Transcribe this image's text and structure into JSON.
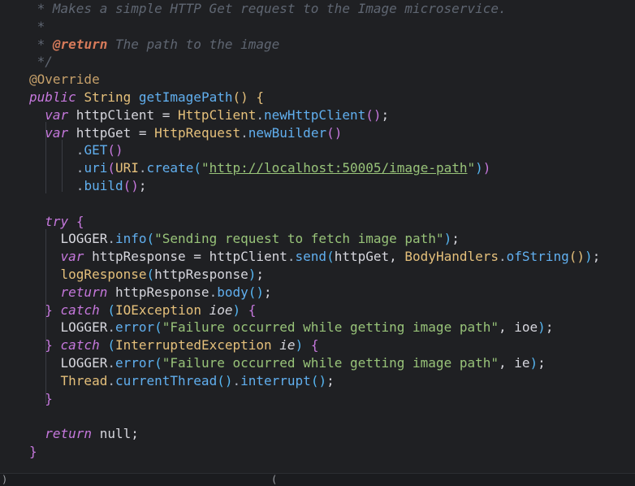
{
  "editor": {
    "lines": [
      [
        {
          "t": " * Makes a simple HTTP Get request to the Image microservice.",
          "k": "comment"
        }
      ],
      [
        {
          "t": " *",
          "k": "comment"
        }
      ],
      [
        {
          "t": " * ",
          "k": "comment"
        },
        {
          "t": "@return",
          "k": "doctag"
        },
        {
          "t": " The path to the image",
          "k": "comment"
        }
      ],
      [
        {
          "t": " */",
          "k": "comment"
        }
      ],
      [
        {
          "t": "@Override",
          "k": "annot"
        }
      ],
      [
        {
          "t": "public",
          "k": "kw"
        },
        {
          "t": " ",
          "k": "plain"
        },
        {
          "t": "String",
          "k": "type"
        },
        {
          "t": " ",
          "k": "plain"
        },
        {
          "t": "getImagePath",
          "k": "fn"
        },
        {
          "t": "()",
          "k": "b1"
        },
        {
          "t": " ",
          "k": "plain"
        },
        {
          "t": "{",
          "k": "b1"
        }
      ],
      [
        {
          "t": "  var",
          "k": "kw"
        },
        {
          "t": " httpClient = ",
          "k": "plain"
        },
        {
          "t": "HttpClient",
          "k": "type"
        },
        {
          "t": ".",
          "k": "punct"
        },
        {
          "t": "newHttpClient",
          "k": "fn"
        },
        {
          "t": "()",
          "k": "b2"
        },
        {
          "t": ";",
          "k": "plain"
        }
      ],
      [
        {
          "t": "  var",
          "k": "kw"
        },
        {
          "t": " httpGet = ",
          "k": "plain"
        },
        {
          "t": "HttpRequest",
          "k": "type"
        },
        {
          "t": ".",
          "k": "punct"
        },
        {
          "t": "newBuilder",
          "k": "fn"
        },
        {
          "t": "()",
          "k": "b2"
        }
      ],
      [
        {
          "t": "      .",
          "k": "punct"
        },
        {
          "t": "GET",
          "k": "fn"
        },
        {
          "t": "()",
          "k": "b2"
        }
      ],
      [
        {
          "t": "      .",
          "k": "punct"
        },
        {
          "t": "uri",
          "k": "fn"
        },
        {
          "t": "(",
          "k": "b2"
        },
        {
          "t": "URI",
          "k": "type"
        },
        {
          "t": ".",
          "k": "punct"
        },
        {
          "t": "create",
          "k": "fn"
        },
        {
          "t": "(",
          "k": "b3"
        },
        {
          "t": "\"",
          "k": "str"
        },
        {
          "t": "http://localhost:50005/image-path",
          "k": "url"
        },
        {
          "t": "\"",
          "k": "str"
        },
        {
          "t": ")",
          "k": "b3"
        },
        {
          "t": ")",
          "k": "b2"
        }
      ],
      [
        {
          "t": "      .",
          "k": "punct"
        },
        {
          "t": "build",
          "k": "fn"
        },
        {
          "t": "()",
          "k": "b2"
        },
        {
          "t": ";",
          "k": "plain"
        }
      ],
      [],
      [
        {
          "t": "  try",
          "k": "kw"
        },
        {
          "t": " ",
          "k": "plain"
        },
        {
          "t": "{",
          "k": "b2"
        }
      ],
      [
        {
          "t": "    LOGGER",
          "k": "plain"
        },
        {
          "t": ".",
          "k": "punct"
        },
        {
          "t": "info",
          "k": "fn"
        },
        {
          "t": "(",
          "k": "b3"
        },
        {
          "t": "\"Sending request to fetch image path\"",
          "k": "str"
        },
        {
          "t": ")",
          "k": "b3"
        },
        {
          "t": ";",
          "k": "plain"
        }
      ],
      [
        {
          "t": "    var",
          "k": "kw"
        },
        {
          "t": " httpResponse = httpClient",
          "k": "plain"
        },
        {
          "t": ".",
          "k": "punct"
        },
        {
          "t": "send",
          "k": "fn"
        },
        {
          "t": "(",
          "k": "b3"
        },
        {
          "t": "httpGet, ",
          "k": "plain"
        },
        {
          "t": "BodyHandlers",
          "k": "type"
        },
        {
          "t": ".",
          "k": "punct"
        },
        {
          "t": "ofString",
          "k": "fn"
        },
        {
          "t": "()",
          "k": "b1"
        },
        {
          "t": ")",
          "k": "b3"
        },
        {
          "t": ";",
          "k": "plain"
        }
      ],
      [
        {
          "t": "    logResponse",
          "k": "type"
        },
        {
          "t": "(",
          "k": "b3"
        },
        {
          "t": "httpResponse",
          "k": "plain"
        },
        {
          "t": ")",
          "k": "b3"
        },
        {
          "t": ";",
          "k": "plain"
        }
      ],
      [
        {
          "t": "    return",
          "k": "kw"
        },
        {
          "t": " httpResponse",
          "k": "plain"
        },
        {
          "t": ".",
          "k": "punct"
        },
        {
          "t": "body",
          "k": "fn"
        },
        {
          "t": "()",
          "k": "b3"
        },
        {
          "t": ";",
          "k": "plain"
        }
      ],
      [
        {
          "t": "  }",
          "k": "b2"
        },
        {
          "t": " ",
          "k": "plain"
        },
        {
          "t": "catch",
          "k": "kw"
        },
        {
          "t": " ",
          "k": "plain"
        },
        {
          "t": "(",
          "k": "b3"
        },
        {
          "t": "IOException",
          "k": "type"
        },
        {
          "t": " ",
          "k": "plain"
        },
        {
          "t": "ioe",
          "k": "param"
        },
        {
          "t": ")",
          "k": "b3"
        },
        {
          "t": " ",
          "k": "plain"
        },
        {
          "t": "{",
          "k": "b2"
        }
      ],
      [
        {
          "t": "    LOGGER",
          "k": "plain"
        },
        {
          "t": ".",
          "k": "punct"
        },
        {
          "t": "error",
          "k": "fn"
        },
        {
          "t": "(",
          "k": "b3"
        },
        {
          "t": "\"Failure occurred while getting image path\"",
          "k": "str"
        },
        {
          "t": ", ioe",
          "k": "plain"
        },
        {
          "t": ")",
          "k": "b3"
        },
        {
          "t": ";",
          "k": "plain"
        }
      ],
      [
        {
          "t": "  }",
          "k": "b2"
        },
        {
          "t": " ",
          "k": "plain"
        },
        {
          "t": "catch",
          "k": "kw"
        },
        {
          "t": " ",
          "k": "plain"
        },
        {
          "t": "(",
          "k": "b3"
        },
        {
          "t": "InterruptedException",
          "k": "type"
        },
        {
          "t": " ",
          "k": "plain"
        },
        {
          "t": "ie",
          "k": "param"
        },
        {
          "t": ")",
          "k": "b3"
        },
        {
          "t": " ",
          "k": "plain"
        },
        {
          "t": "{",
          "k": "b2"
        }
      ],
      [
        {
          "t": "    LOGGER",
          "k": "plain"
        },
        {
          "t": ".",
          "k": "punct"
        },
        {
          "t": "error",
          "k": "fn"
        },
        {
          "t": "(",
          "k": "b3"
        },
        {
          "t": "\"Failure occurred while getting image path\"",
          "k": "str"
        },
        {
          "t": ", ie",
          "k": "plain"
        },
        {
          "t": ")",
          "k": "b3"
        },
        {
          "t": ";",
          "k": "plain"
        }
      ],
      [
        {
          "t": "    Thread",
          "k": "type"
        },
        {
          "t": ".",
          "k": "punct"
        },
        {
          "t": "currentThread",
          "k": "fn"
        },
        {
          "t": "()",
          "k": "b3"
        },
        {
          "t": ".",
          "k": "punct"
        },
        {
          "t": "interrupt",
          "k": "fn"
        },
        {
          "t": "()",
          "k": "b3"
        },
        {
          "t": ";",
          "k": "plain"
        }
      ],
      [
        {
          "t": "  }",
          "k": "b2"
        }
      ],
      [],
      [
        {
          "t": "  return",
          "k": "kw"
        },
        {
          "t": " null;",
          "k": "plain"
        }
      ],
      [
        {
          "t": "}",
          "k": "b2"
        }
      ]
    ]
  },
  "colors": {
    "background": "#1f2023",
    "comment": "#5f6672",
    "keyword": "#c678dd",
    "type": "#e5c07b",
    "function": "#61afef",
    "string": "#98c379",
    "annotation": "#c6a06a"
  }
}
